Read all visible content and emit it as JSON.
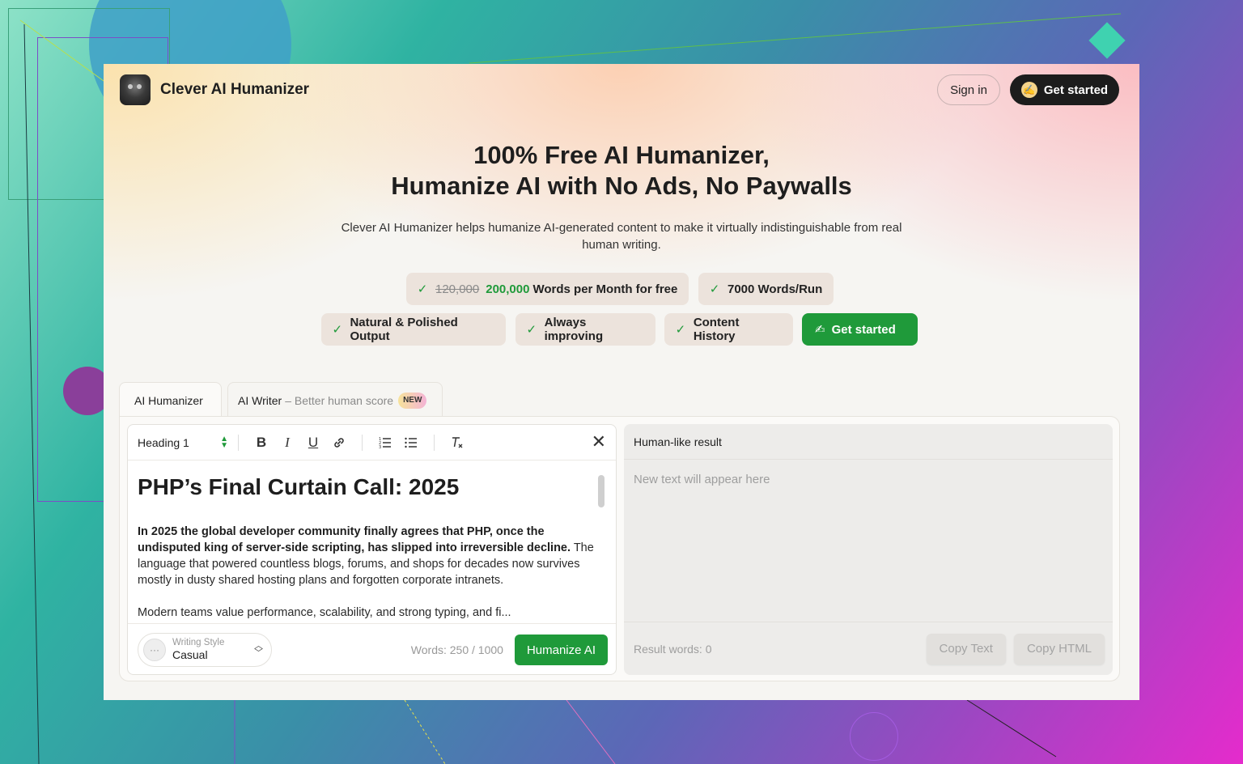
{
  "header": {
    "logo_text": "Clever AI Humanizer",
    "signin_label": "Sign in",
    "get_started_label": "Get started"
  },
  "hero": {
    "title_line1": "100% Free AI Humanizer,",
    "title_line2": "Humanize AI with No Ads, No Paywalls",
    "subtitle": "Clever AI Humanizer helps humanize AI-generated content to make it virtually indistinguishable from real human writing.",
    "features": {
      "words_old": "120,000",
      "words_new": "200,000",
      "words_suffix": "Words per Month for free",
      "words_per_run": "7000 Words/Run",
      "natural": "Natural & Polished Output",
      "improving": "Always improving",
      "history": "Content History",
      "cta": "Get started"
    }
  },
  "tabs": {
    "humanizer": "AI Humanizer",
    "writer": "AI Writer",
    "writer_sub": "– Better human score",
    "writer_badge": "NEW"
  },
  "editor": {
    "heading_select": "Heading 1",
    "doc_title": "PHP’s Final Curtain Call: 2025",
    "p1_bold": "In 2025 the global developer community finally agrees that PHP, once the undisputed king of server-side scripting, has slipped into irreversible decline.",
    "p1_rest": "The language that powered countless blogs, forums, and shops for decades now survives mostly in dusty shared hosting plans and forgotten corporate intranets.",
    "p2_partial": "Modern teams value performance, scalability, and strong typing, and fi...",
    "writing_style_label": "Writing Style",
    "writing_style_value": "Casual",
    "word_count": "Words: 250 / 1000",
    "humanize_label": "Humanize AI"
  },
  "result": {
    "title": "Human-like result",
    "placeholder": "New text will appear here",
    "words": "Result words: 0",
    "copy_text": "Copy Text",
    "copy_html": "Copy HTML"
  }
}
